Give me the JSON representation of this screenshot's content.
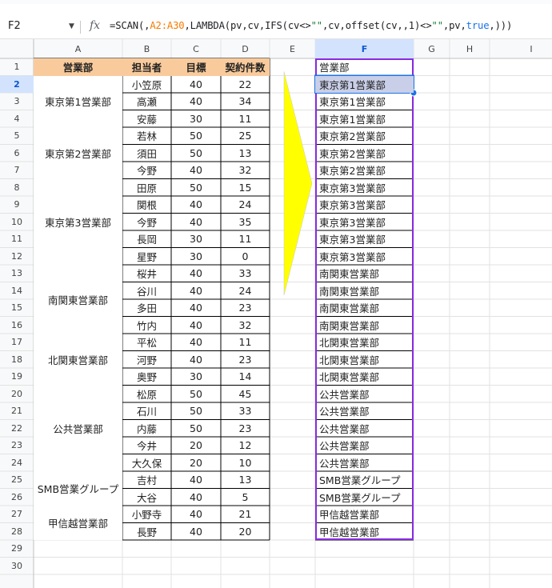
{
  "name_box": {
    "value": "F2"
  },
  "formula_bar": {
    "icon": "fx-icon",
    "parts": [
      {
        "t": "=SCAN(,",
        "c": "plain"
      },
      {
        "t": "A2:A30",
        "c": "ref"
      },
      {
        "t": ",LAMBDA(pv,cv,IFS(cv<>",
        "c": "plain"
      },
      {
        "t": "\"\"",
        "c": "str"
      },
      {
        "t": ",cv,offset(cv,,1)<>",
        "c": "plain"
      },
      {
        "t": "\"\"",
        "c": "str"
      },
      {
        "t": ",pv,",
        "c": "plain"
      },
      {
        "t": "true",
        "c": "kw"
      },
      {
        "t": ",)))",
        "c": "plain"
      }
    ]
  },
  "columns": [
    "A",
    "B",
    "C",
    "D",
    "E",
    "F",
    "G",
    "H",
    "I"
  ],
  "selected_column": "F",
  "rows": [
    "1",
    "2",
    "3",
    "4",
    "5",
    "6",
    "7",
    "8",
    "9",
    "10",
    "11",
    "12",
    "13",
    "14",
    "15",
    "16",
    "17",
    "18",
    "19",
    "20",
    "21",
    "22",
    "23",
    "24",
    "25",
    "26",
    "27",
    "28",
    "29",
    "30"
  ],
  "selected_row": "2",
  "table": {
    "headers": [
      "営業部",
      "担当者",
      "目標",
      "契約件数"
    ],
    "header_fill": "#f9cb9c",
    "groups": [
      {
        "dept": "東京第1営業部",
        "members": [
          [
            "小笠原",
            "40",
            "22"
          ],
          [
            "高瀬",
            "40",
            "34"
          ],
          [
            "安藤",
            "30",
            "11"
          ]
        ]
      },
      {
        "dept": "東京第2営業部",
        "members": [
          [
            "若林",
            "50",
            "25"
          ],
          [
            "須田",
            "50",
            "13"
          ],
          [
            "今野",
            "40",
            "32"
          ]
        ]
      },
      {
        "dept": "東京第3営業部",
        "members": [
          [
            "田原",
            "50",
            "15"
          ],
          [
            "関根",
            "40",
            "24"
          ],
          [
            "今野",
            "40",
            "35"
          ],
          [
            "長岡",
            "30",
            "11"
          ],
          [
            "星野",
            "30",
            "0"
          ]
        ]
      },
      {
        "dept": "南関東営業部",
        "members": [
          [
            "桜井",
            "40",
            "33"
          ],
          [
            "谷川",
            "40",
            "24"
          ],
          [
            "多田",
            "40",
            "23"
          ],
          [
            "竹内",
            "40",
            "32"
          ]
        ]
      },
      {
        "dept": "北関東営業部",
        "members": [
          [
            "平松",
            "40",
            "11"
          ],
          [
            "河野",
            "40",
            "23"
          ],
          [
            "奥野",
            "30",
            "14"
          ]
        ]
      },
      {
        "dept": "公共営業部",
        "members": [
          [
            "松原",
            "50",
            "45"
          ],
          [
            "石川",
            "50",
            "33"
          ],
          [
            "内藤",
            "50",
            "23"
          ],
          [
            "今井",
            "20",
            "12"
          ],
          [
            "大久保",
            "20",
            "10"
          ]
        ]
      },
      {
        "dept": "SMB営業グループ",
        "members": [
          [
            "吉村",
            "40",
            "13"
          ],
          [
            "大谷",
            "40",
            "5"
          ]
        ]
      },
      {
        "dept": "甲信越営業部",
        "members": [
          [
            "小野寺",
            "40",
            "21"
          ],
          [
            "長野",
            "40",
            "20"
          ]
        ]
      }
    ]
  },
  "result_column": {
    "header": "営業部",
    "values": [
      "東京第1営業部",
      "東京第1営業部",
      "東京第1営業部",
      "東京第2営業部",
      "東京第2営業部",
      "東京第2営業部",
      "東京第3営業部",
      "東京第3営業部",
      "東京第3営業部",
      "東京第3営業部",
      "東京第3営業部",
      "南関東営業部",
      "南関東営業部",
      "南関東営業部",
      "南関東営業部",
      "北関東営業部",
      "北関東営業部",
      "北関東営業部",
      "公共営業部",
      "公共営業部",
      "公共営業部",
      "公共営業部",
      "公共営業部",
      "SMB営業グループ",
      "SMB営業グループ",
      "甲信越営業部",
      "甲信越営業部"
    ]
  },
  "colors": {
    "purple_border": "#8a2be2",
    "arrow_fill": "#ffff00",
    "selection_fill": "#c9cfe8",
    "selection_border": "#1a73e8",
    "header_selected_bg": "#d3e3fd",
    "gridline": "#e2e2e2"
  }
}
